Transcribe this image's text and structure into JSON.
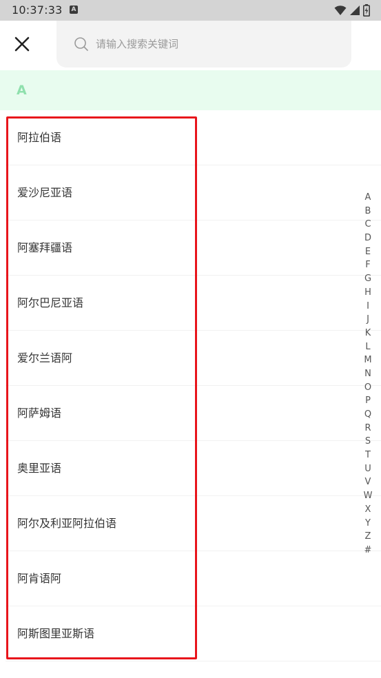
{
  "status_bar": {
    "time": "10:37:33",
    "notification_icon_letter": "A"
  },
  "search": {
    "placeholder": "请输入搜索关键词",
    "value": ""
  },
  "section": {
    "letter": "A"
  },
  "languages": [
    "阿拉伯语",
    "爱沙尼亚语",
    "阿塞拜疆语",
    "阿尔巴尼亚语",
    "爱尔兰语阿",
    "阿萨姆语",
    "奥里亚语",
    "阿尔及利亚阿拉伯语",
    "阿肯语阿",
    "阿斯图里亚斯语"
  ],
  "index_letters": [
    "A",
    "B",
    "C",
    "D",
    "E",
    "F",
    "G",
    "H",
    "I",
    "J",
    "K",
    "L",
    "M",
    "N",
    "O",
    "P",
    "Q",
    "R",
    "S",
    "T",
    "U",
    "V",
    "W",
    "X",
    "Y",
    "Z",
    "#"
  ],
  "colors": {
    "section_bg": "#e8fcef",
    "section_letter": "#8fe0ad",
    "highlight_border": "#e8141b",
    "status_bar_bg": "#d4d4d4"
  }
}
